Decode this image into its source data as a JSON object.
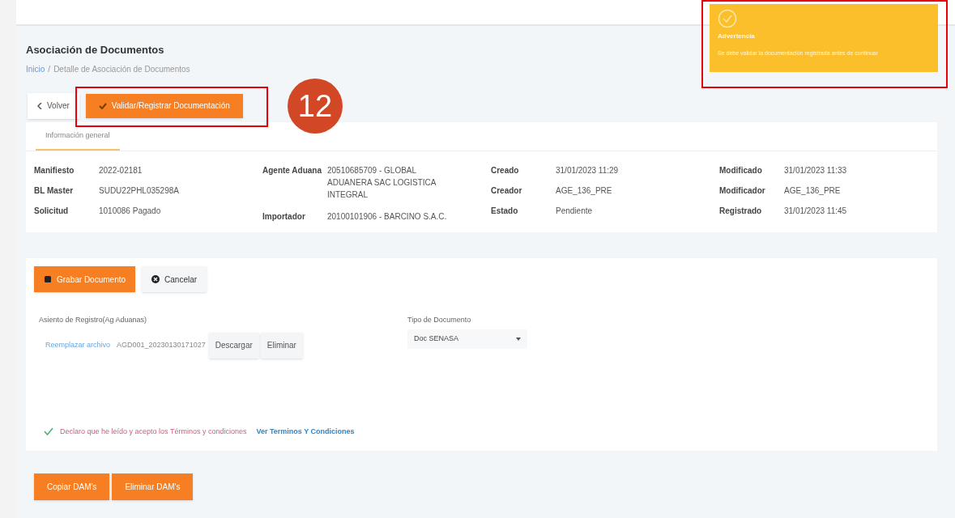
{
  "page": {
    "title": "Asociación de Documentos",
    "breadcrumb": {
      "home": "Inicio",
      "separator": "/",
      "current": "Detalle de Asociación de Documentos"
    }
  },
  "actions": [
    {
      "label": "Volver",
      "kind": "back"
    },
    {
      "label": "Validar/Registrar Documentación",
      "kind": "primary"
    }
  ],
  "annotation": {
    "number": "12"
  },
  "toast": {
    "title": "Advertencia",
    "message": "Se debe validar la documentación registrada antes de continuar"
  },
  "tabs": [
    {
      "label": "Información general",
      "selected": true
    }
  ],
  "info_columns": [
    [
      {
        "label": "Manifiesto",
        "value": "2022-02181"
      },
      {
        "label": "BL Master",
        "value": "SUDU22PHL035298A"
      },
      {
        "label": "Solicitud",
        "value": "1010086 Pagado"
      }
    ],
    [
      {
        "label": "Agente Aduana",
        "value": "20510685709 - GLOBAL ADUANERA SAC LOGISTICA INTEGRAL"
      },
      {
        "label": "Importador",
        "value": "20100101906 - BARCINO S.A.C."
      }
    ],
    [
      {
        "label": "Creado",
        "value": "31/01/2023 11:29"
      },
      {
        "label": "Creador",
        "value": "AGE_136_PRE"
      },
      {
        "label": "Estado",
        "value": "Pendiente"
      }
    ],
    [
      {
        "label": "Modificado",
        "value": "31/01/2023 11:33"
      },
      {
        "label": "Modificador",
        "value": "AGE_136_PRE"
      },
      {
        "label": "Registrado",
        "value": "31/01/2023 11:45"
      }
    ]
  ],
  "form_buttons": [
    {
      "label": "Grabar Documento",
      "kind": "primary"
    },
    {
      "label": "Cancelar",
      "kind": "cancel"
    }
  ],
  "file_field": {
    "label": "Asiento de Registro(Ag Aduanas)",
    "replace_link": "Reemplazar archivo",
    "filename": "AGD001_20230130171027",
    "buttons": [
      "Descargar",
      "Eliminar"
    ]
  },
  "doc_type": {
    "label": "Tipo de Documento",
    "value": "Doc SENASA"
  },
  "terms": {
    "checked": true,
    "text": "Declaro que he leído y acepto los Términos y condiciones",
    "link": "Ver Terminos Y Condiciones"
  },
  "bottom_buttons": [
    "Copiar DAM's",
    "Eliminar DAM's"
  ]
}
